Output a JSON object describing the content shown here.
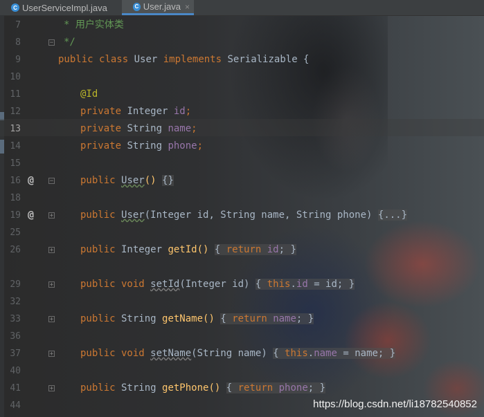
{
  "tabs": [
    {
      "label": "UserServiceImpl.java",
      "icon": "class-c-icon",
      "active": false
    },
    {
      "label": "User.java",
      "icon": "class-c-icon",
      "active": true
    }
  ],
  "gutter": {
    "line_numbers": [
      "7",
      "8",
      "9",
      "10",
      "11",
      "12",
      "13",
      "14",
      "15",
      "16",
      "18",
      "19",
      "25",
      "26",
      "29",
      "32",
      "33",
      "36",
      "37",
      "40",
      "41",
      "44"
    ],
    "current_line": "13"
  },
  "code": {
    "l7": "* 用户实体类",
    "l8": "*/",
    "l9": {
      "kw1": "public",
      "kw2": "class",
      "name": " User ",
      "kw3": "implements",
      "rest": " Serializable {"
    },
    "l11": "@Id",
    "l12": {
      "kw": "private",
      "type": " Integer ",
      "field": "id",
      "end": ";"
    },
    "l13": {
      "kw": "private",
      "type": " String ",
      "field": "name",
      "end": ";"
    },
    "l14": {
      "kw": "private",
      "type": " String ",
      "field": "phone",
      "end": ";"
    },
    "l16": {
      "kw": "public",
      "ctor": "User",
      "paren": "()",
      "body": "{}"
    },
    "l19": {
      "kw": "public",
      "ctor": "User",
      "params": "(Integer id, String name, String phone) ",
      "body": "{...}"
    },
    "l26": {
      "kw": "public",
      "type": " Integer ",
      "method": "getId",
      "paren": "() ",
      "b1": "{ ",
      "ret": "return",
      "f": " id",
      "b2": "; }"
    },
    "l29": {
      "kw": "public",
      "void": " void ",
      "method": "setId",
      "params": "(Integer id) ",
      "b1": "{ ",
      "this": "this",
      "dot": ".",
      "f": "id",
      "rest": " = id; }"
    },
    "l33": {
      "kw": "public",
      "type": " String ",
      "method": "getName",
      "paren": "() ",
      "b1": "{ ",
      "ret": "return",
      "f": " name",
      "b2": "; }"
    },
    "l37": {
      "kw": "public",
      "void": " void ",
      "method": "setName",
      "params": "(String name) ",
      "b1": "{ ",
      "this": "this",
      "dot": ".",
      "f": "name",
      "rest": " = name; }"
    },
    "l41": {
      "kw": "public",
      "type": " String ",
      "method": "getPhone",
      "paren": "() ",
      "b1": "{ ",
      "ret": "return",
      "f": " phone",
      "b2": "; }"
    }
  },
  "watermark": "https://blog.csdn.net/li18782540852",
  "colors": {
    "keyword": "#cc7832",
    "comment": "#629755",
    "annotation": "#bbb529",
    "field": "#9876aa",
    "method": "#ffc66d",
    "text": "#a9b7c6"
  }
}
